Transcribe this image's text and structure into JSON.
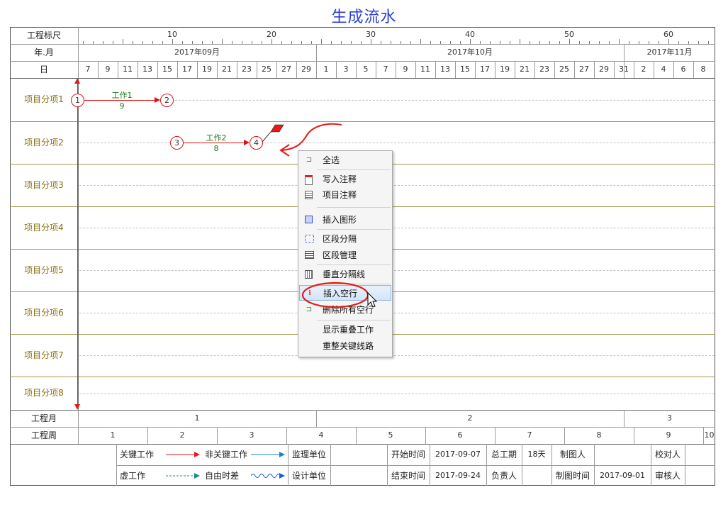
{
  "title": "生成流水",
  "header": {
    "scale_label": "工程标尺",
    "scale_ticks": [
      "10",
      "20",
      "30",
      "40",
      "50",
      "60"
    ],
    "month_label": "年.月",
    "months": [
      "2017年09月",
      "2017年10月",
      "2017年11月"
    ],
    "day_label": "日",
    "days": [
      "7",
      "9",
      "11",
      "13",
      "15",
      "17",
      "19",
      "21",
      "23",
      "25",
      "27",
      "29",
      "1",
      "3",
      "5",
      "7",
      "9",
      "11",
      "13",
      "15",
      "17",
      "19",
      "21",
      "23",
      "25",
      "27",
      "29",
      "31",
      "2",
      "4",
      "6",
      "8"
    ]
  },
  "rows": [
    "项目分项1",
    "项目分项2",
    "项目分项3",
    "项目分项4",
    "项目分项5",
    "项目分项6",
    "项目分项7",
    "项目分项8"
  ],
  "activities": [
    {
      "name": "工作1",
      "duration": "9",
      "from": "1",
      "to": "2"
    },
    {
      "name": "工作2",
      "duration": "8",
      "from": "3",
      "to": "4"
    }
  ],
  "context_menu": {
    "items": [
      {
        "label": "全选",
        "icon": "select-all-icon"
      },
      {
        "label": "写入注释",
        "icon": "write-note-icon"
      },
      {
        "label": "项目注释",
        "icon": "project-note-icon"
      },
      {
        "label": "插入图形",
        "icon": "insert-shape-icon"
      },
      {
        "label": "区段分隔",
        "icon": "section-divide-icon"
      },
      {
        "label": "区段管理",
        "icon": "section-manage-icon"
      },
      {
        "label": "垂直分隔线",
        "icon": "vertical-divider-icon"
      },
      {
        "label": "插入空行",
        "icon": "insert-row-icon"
      },
      {
        "label": "删除所有空行",
        "icon": "delete-rows-icon"
      },
      {
        "label": "显示重叠工作",
        "icon": ""
      },
      {
        "label": "重整关键线路",
        "icon": ""
      }
    ],
    "highlighted": "插入空行"
  },
  "footer": {
    "project_month_label": "工程月",
    "project_months": [
      "1",
      "2",
      "3"
    ],
    "project_week_label": "工程周",
    "project_weeks": [
      "1",
      "2",
      "3",
      "4",
      "5",
      "6",
      "7",
      "8",
      "9",
      "10"
    ]
  },
  "legend": {
    "critical": "关键工作",
    "noncritical": "非关键工作",
    "dummy": "虚工作",
    "free_float": "自由时差",
    "supervisor_label": "监理单位",
    "design_label": "设计单位",
    "start_label": "开始时间",
    "start_value": "2017-09-07",
    "end_label": "结束时间",
    "end_value": "2017-09-24",
    "total_label": "总工期",
    "total_value": "18天",
    "responsible_label": "负责人",
    "drafter_label": "制图人",
    "draft_time_label": "制图时间",
    "draft_time_value": "2017-09-01",
    "checker_label": "校对人",
    "reviewer_label": "审核人",
    "colors": {
      "critical": "#e31b1b",
      "noncritical": "#1a7fd8",
      "dummy": "#1a8a8a",
      "free_float": "#1a5fd8"
    }
  }
}
